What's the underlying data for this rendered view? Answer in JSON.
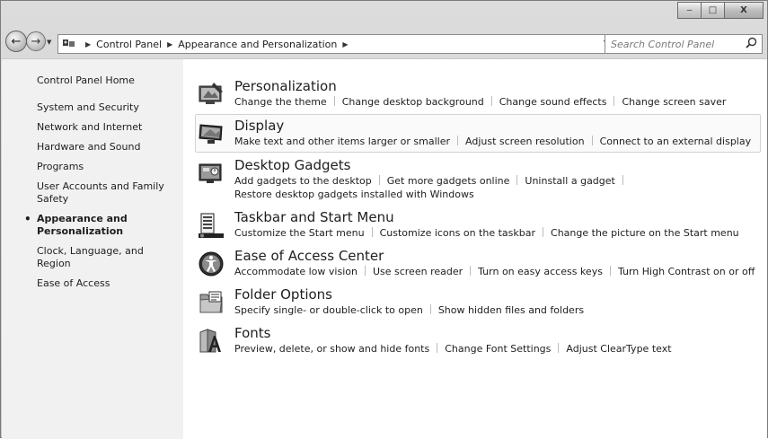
{
  "window": {
    "minimize_glyph": "‒",
    "maximize_glyph": "□",
    "close_glyph": "X"
  },
  "nav": {
    "back_glyph": "←",
    "forward_glyph": "→",
    "recent_glyph": "▼"
  },
  "address": {
    "crumbs": [
      "Control Panel",
      "Appearance and Personalization"
    ],
    "separator": "▶",
    "refresh_glyph": "↻"
  },
  "search": {
    "placeholder": "Search Control Panel"
  },
  "sidebar": {
    "home": "Control Panel Home",
    "items": [
      "System and Security",
      "Network and Internet",
      "Hardware and Sound",
      "Programs",
      "User Accounts and Family Safety",
      "Appearance and Personalization",
      "Clock, Language, and Region",
      "Ease of Access"
    ],
    "active_index": 5
  },
  "categories": [
    {
      "title": "Personalization",
      "icon": "personalization-icon",
      "tasks": [
        "Change the theme",
        "Change desktop background",
        "Change sound effects",
        "Change screen saver"
      ]
    },
    {
      "title": "Display",
      "icon": "display-icon",
      "tasks": [
        "Make text and other items larger or smaller",
        "Adjust screen resolution",
        "Connect to an external display"
      ]
    },
    {
      "title": "Desktop Gadgets",
      "icon": "gadgets-icon",
      "tasks": [
        "Add gadgets to the desktop",
        "Get more gadgets online",
        "Uninstall a gadget",
        "Restore desktop gadgets installed with Windows"
      ]
    },
    {
      "title": "Taskbar and Start Menu",
      "icon": "taskbar-icon",
      "tasks": [
        "Customize the Start menu",
        "Customize icons on the taskbar",
        "Change the picture on the Start menu"
      ]
    },
    {
      "title": "Ease of Access Center",
      "icon": "ease-of-access-icon",
      "tasks": [
        "Accommodate low vision",
        "Use screen reader",
        "Turn on easy access keys",
        "Turn High Contrast on or off"
      ]
    },
    {
      "title": "Folder Options",
      "icon": "folder-options-icon",
      "tasks": [
        "Specify single- or double-click to open",
        "Show hidden files and folders"
      ]
    },
    {
      "title": "Fonts",
      "icon": "fonts-icon",
      "tasks": [
        "Preview, delete, or show and hide fonts",
        "Change Font Settings",
        "Adjust ClearType text"
      ]
    }
  ]
}
